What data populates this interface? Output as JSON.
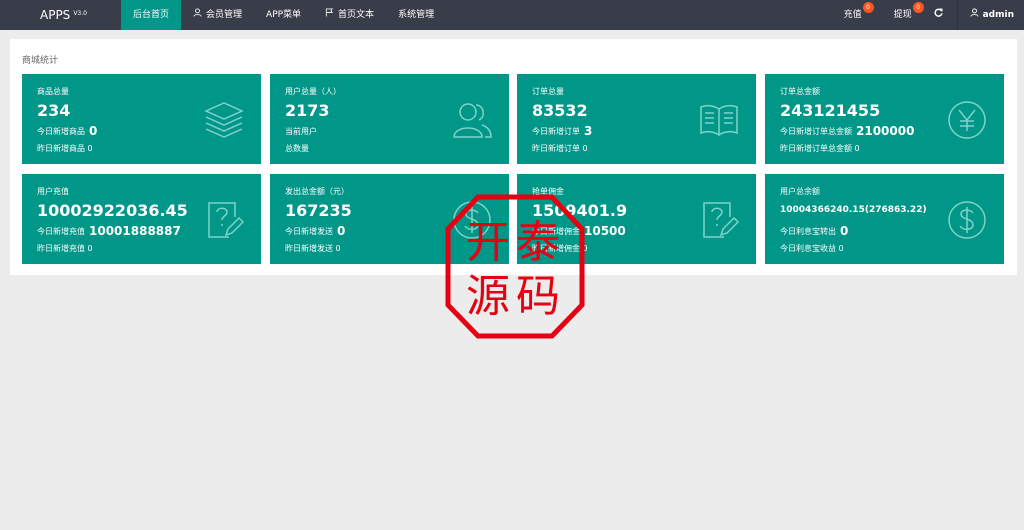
{
  "header": {
    "app_name": "APPS",
    "version": "V3.0",
    "nav": [
      {
        "label": "后台首页",
        "icon": ""
      },
      {
        "label": "会员管理",
        "icon": "user-icon"
      },
      {
        "label": "APP菜单",
        "icon": ""
      },
      {
        "label": "首页文本",
        "icon": "flag-icon"
      },
      {
        "label": "系统管理",
        "icon": ""
      }
    ],
    "recharge_label": "充值",
    "recharge_badge": "0",
    "withdraw_label": "提现",
    "withdraw_badge": "0",
    "refresh_icon": "refresh-icon",
    "user_label": "admin"
  },
  "main": {
    "section_title": "商城统计",
    "cards": [
      {
        "label": "商品总量",
        "value": "234",
        "line1_label": "今日新增商品",
        "line1_value": "0",
        "line2": "昨日新增商品 0",
        "icon": "layers-icon"
      },
      {
        "label": "用户总量（人）",
        "value": "2173",
        "line1_label": "当前用户",
        "line1_value": "",
        "line2": "总数量",
        "icon": "users-icon"
      },
      {
        "label": "订单总量",
        "value": "83532",
        "line1_label": "今日新增订单",
        "line1_value": "3",
        "line2": "昨日新增订单 0",
        "icon": "book-icon"
      },
      {
        "label": "订单总金额",
        "value": "243121455",
        "line1_label": "今日新增订单总金额",
        "line1_value": "2100000",
        "line2": "昨日新增订单总金额 0",
        "icon": "yen-icon"
      },
      {
        "label": "用户充值",
        "value": "10002922036.45",
        "line1_label": "今日新增充值",
        "line1_value": "10001888887",
        "line2": "昨日新增充值 0",
        "icon": "edit-note-icon"
      },
      {
        "label": "发出总金额（元）",
        "value": "167235",
        "line1_label": "今日新增发送",
        "line1_value": "0",
        "line2": "昨日新增发送 0",
        "icon": "dollar-icon"
      },
      {
        "label": "抢单佣金",
        "value": "1509401.9",
        "line1_label": "今日新增佣金",
        "line1_value": "10500",
        "line2": "昨日新增佣金 0",
        "icon": "edit-note-icon"
      },
      {
        "label": "用户总余额",
        "value": "10004366240.15(276863.22)",
        "line1_label": "今日利息宝转出",
        "line1_value": "0",
        "line2": "今日利息宝收益 0",
        "icon": "dollar-icon"
      }
    ]
  },
  "watermark": {
    "text": "开泰源码",
    "color": "#e60012"
  }
}
